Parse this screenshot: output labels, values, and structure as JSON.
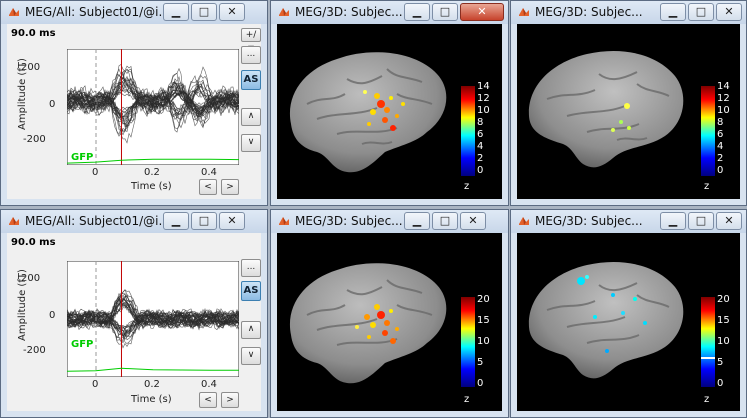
{
  "windows": [
    {
      "id": "ts1",
      "title": "MEG/All: Subject01/@i...",
      "time_label": "90.0 ms",
      "kind": "ts"
    },
    {
      "id": "d3a",
      "title": "MEG/3D: Subjec...",
      "kind": "3d"
    },
    {
      "id": "d3b",
      "title": "MEG/3D: Subjec...",
      "kind": "3d"
    },
    {
      "id": "ts2",
      "title": "MEG/All: Subject01/@i...",
      "time_label": "90.0 ms",
      "kind": "ts"
    },
    {
      "id": "d3c",
      "title": "MEG/3D: Subjec...",
      "kind": "3d"
    },
    {
      "id": "d3d",
      "title": "MEG/3D: Subjec...",
      "kind": "3d"
    }
  ],
  "window_controls": {
    "minimize": "▁",
    "restore": "□",
    "close": "✕"
  },
  "ts_plot": {
    "ylabel": "Amplitude (fT)",
    "xlabel": "Time (s)",
    "yticks": [
      "200",
      "0",
      "-200"
    ],
    "xticks": [
      "0",
      "0.2",
      "0.4"
    ],
    "gfp_label": "GFP",
    "buttons": {
      "scale": "+/−",
      "more": "...",
      "autoscale": "AS",
      "up": "∧",
      "down": "∨",
      "prev": "<",
      "next": ">"
    }
  },
  "colorbar_top": {
    "ticks": [
      "14",
      "12",
      "10",
      "8",
      "6",
      "4",
      "2",
      "0"
    ],
    "unit": "z"
  },
  "colorbar_bottom": {
    "ticks": [
      "20",
      "15",
      "10",
      "5",
      "0"
    ],
    "unit": "z"
  },
  "colors": {
    "trace": "#2b2b2b",
    "cursor": "#c00000",
    "gfp": "#00cc00",
    "brain": "#8d8d8d"
  },
  "icons": {
    "app": "matlab-icon"
  },
  "chart_data": [
    {
      "type": "line",
      "title": "90.0 ms",
      "xlabel": "Time (s)",
      "ylabel": "Amplitude (fT)",
      "xlim": [
        -0.1,
        0.5
      ],
      "ylim": [
        -300,
        300
      ],
      "cursor_time": 0.09,
      "series": [
        {
          "name": "GFP",
          "x": [
            -0.1,
            0.0,
            0.09,
            0.2,
            0.4,
            0.5
          ],
          "y": [
            -290,
            -285,
            -275,
            -270,
            -270,
            -272
          ]
        }
      ]
    },
    {
      "type": "line",
      "title": "90.0 ms",
      "xlabel": "Time (s)",
      "ylabel": "Amplitude (fT)",
      "xlim": [
        -0.1,
        0.5
      ],
      "ylim": [
        -300,
        300
      ],
      "cursor_time": 0.09,
      "series": [
        {
          "name": "GFP",
          "x": [
            -0.1,
            0.0,
            0.09,
            0.2,
            0.4,
            0.5
          ],
          "y": [
            -270,
            -268,
            -255,
            -262,
            -265,
            -265
          ]
        }
      ]
    }
  ]
}
